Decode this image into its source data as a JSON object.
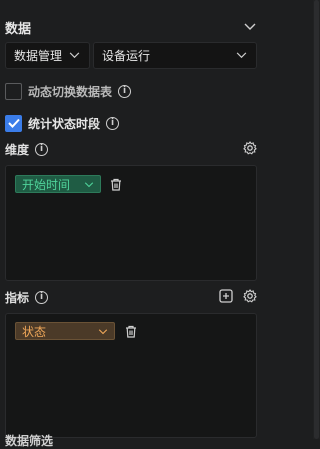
{
  "section": {
    "title": "数据"
  },
  "selects": {
    "dataset_type": "数据管理",
    "dataset_name": "设备运行"
  },
  "options": {
    "dynamic_switch": {
      "label": "动态切换数据表",
      "checked": false
    },
    "stat_time": {
      "label": "统计状态时段",
      "checked": true
    }
  },
  "dimension": {
    "label": "维度",
    "fields": [
      {
        "name": "开始时间"
      }
    ]
  },
  "metric": {
    "label": "指标",
    "fields": [
      {
        "name": "状态"
      }
    ]
  },
  "footer": {
    "partial_label": "数据筛选"
  },
  "colors": {
    "accent": "#3b7de9",
    "dimension_pill": "#4fd39a",
    "metric_pill": "#f0a85a"
  }
}
